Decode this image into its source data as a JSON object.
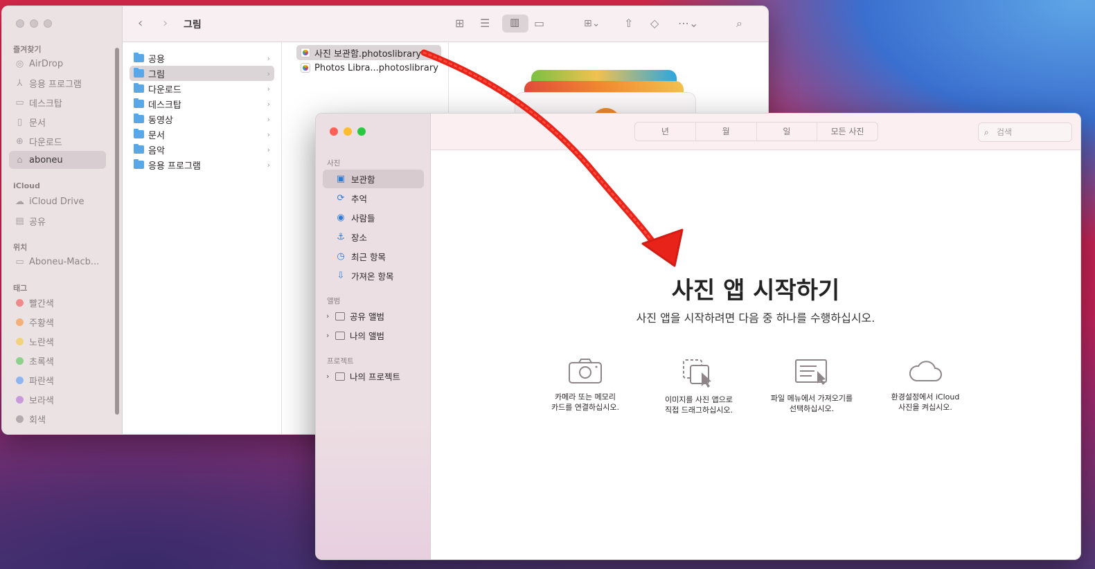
{
  "finder": {
    "title": "그림",
    "sidebar": {
      "favorites_heading": "즐겨찾기",
      "favorites": [
        {
          "label": "AirDrop",
          "icon": "airdrop-icon"
        },
        {
          "label": "응용 프로그램",
          "icon": "applications-icon"
        },
        {
          "label": "데스크탑",
          "icon": "desktop-icon"
        },
        {
          "label": "문서",
          "icon": "document-icon"
        },
        {
          "label": "다운로드",
          "icon": "download-icon"
        },
        {
          "label": "aboneu",
          "icon": "home-icon"
        }
      ],
      "icloud_heading": "iCloud",
      "icloud": [
        {
          "label": "iCloud Drive",
          "icon": "cloud-icon"
        },
        {
          "label": "공유",
          "icon": "shared-folder-icon"
        }
      ],
      "locations_heading": "위치",
      "locations": [
        {
          "label": "Aboneu-Macb...",
          "icon": "laptop-icon"
        }
      ],
      "tags_heading": "태그",
      "tags": [
        {
          "label": "빨간색",
          "color": "#f08a8a"
        },
        {
          "label": "주황색",
          "color": "#f3b07a"
        },
        {
          "label": "노란색",
          "color": "#f2d27c"
        },
        {
          "label": "초록색",
          "color": "#8fd08a"
        },
        {
          "label": "파란색",
          "color": "#8fb5ef"
        },
        {
          "label": "보라색",
          "color": "#c99ad9"
        },
        {
          "label": "회색",
          "color": "#b3acaf"
        }
      ]
    },
    "column1": [
      "공용",
      "그림",
      "다운로드",
      "데스크탑",
      "동영상",
      "문서",
      "음악",
      "응용 프로그램"
    ],
    "column1_selected": "그림",
    "column2": [
      "사진 보관함.photoslibrary",
      "Photos Libra...photoslibrary"
    ]
  },
  "photos": {
    "toolbar": {
      "segments": [
        "년",
        "월",
        "일",
        "모든 사진"
      ],
      "search_placeholder": "검색"
    },
    "sidebar": {
      "photos_heading": "사진",
      "photos_items": [
        {
          "label": "보관함",
          "icon": "library-icon"
        },
        {
          "label": "추억",
          "icon": "memories-icon"
        },
        {
          "label": "사람들",
          "icon": "people-icon"
        },
        {
          "label": "장소",
          "icon": "places-icon"
        },
        {
          "label": "최근 항목",
          "icon": "clock-icon"
        },
        {
          "label": "가져온 항목",
          "icon": "imports-icon"
        }
      ],
      "albums_heading": "앨범",
      "albums_items": [
        "공유 앨범",
        "나의 앨범"
      ],
      "projects_heading": "프로젝트",
      "projects_items": [
        "나의 프로젝트"
      ]
    },
    "main": {
      "title": "사진 앱 시작하기",
      "subtitle": "사진 앱을 시작하려면 다음 중 하나를 수행하십시오.",
      "options": [
        {
          "line1": "카메라 또는 메모리",
          "line2": "카드를 연결하십시오.",
          "icon": "camera-icon"
        },
        {
          "line1": "이미지를 사진 앱으로",
          "line2": "직접 드래그하십시오.",
          "icon": "drag-icon"
        },
        {
          "line1": "파일 메뉴에서 가져오기를",
          "line2": "선택하십시오.",
          "icon": "file-menu-icon"
        },
        {
          "line1": "환경설정에서 iCloud",
          "line2": "사진을 켜십시오.",
          "icon": "icloud-icon"
        }
      ]
    },
    "traffic_colors": [
      "#ff5f57",
      "#febc2e",
      "#28c840"
    ]
  },
  "annotation": {
    "color": "#e8231a",
    "icon": "hand-drawn-arrow"
  }
}
